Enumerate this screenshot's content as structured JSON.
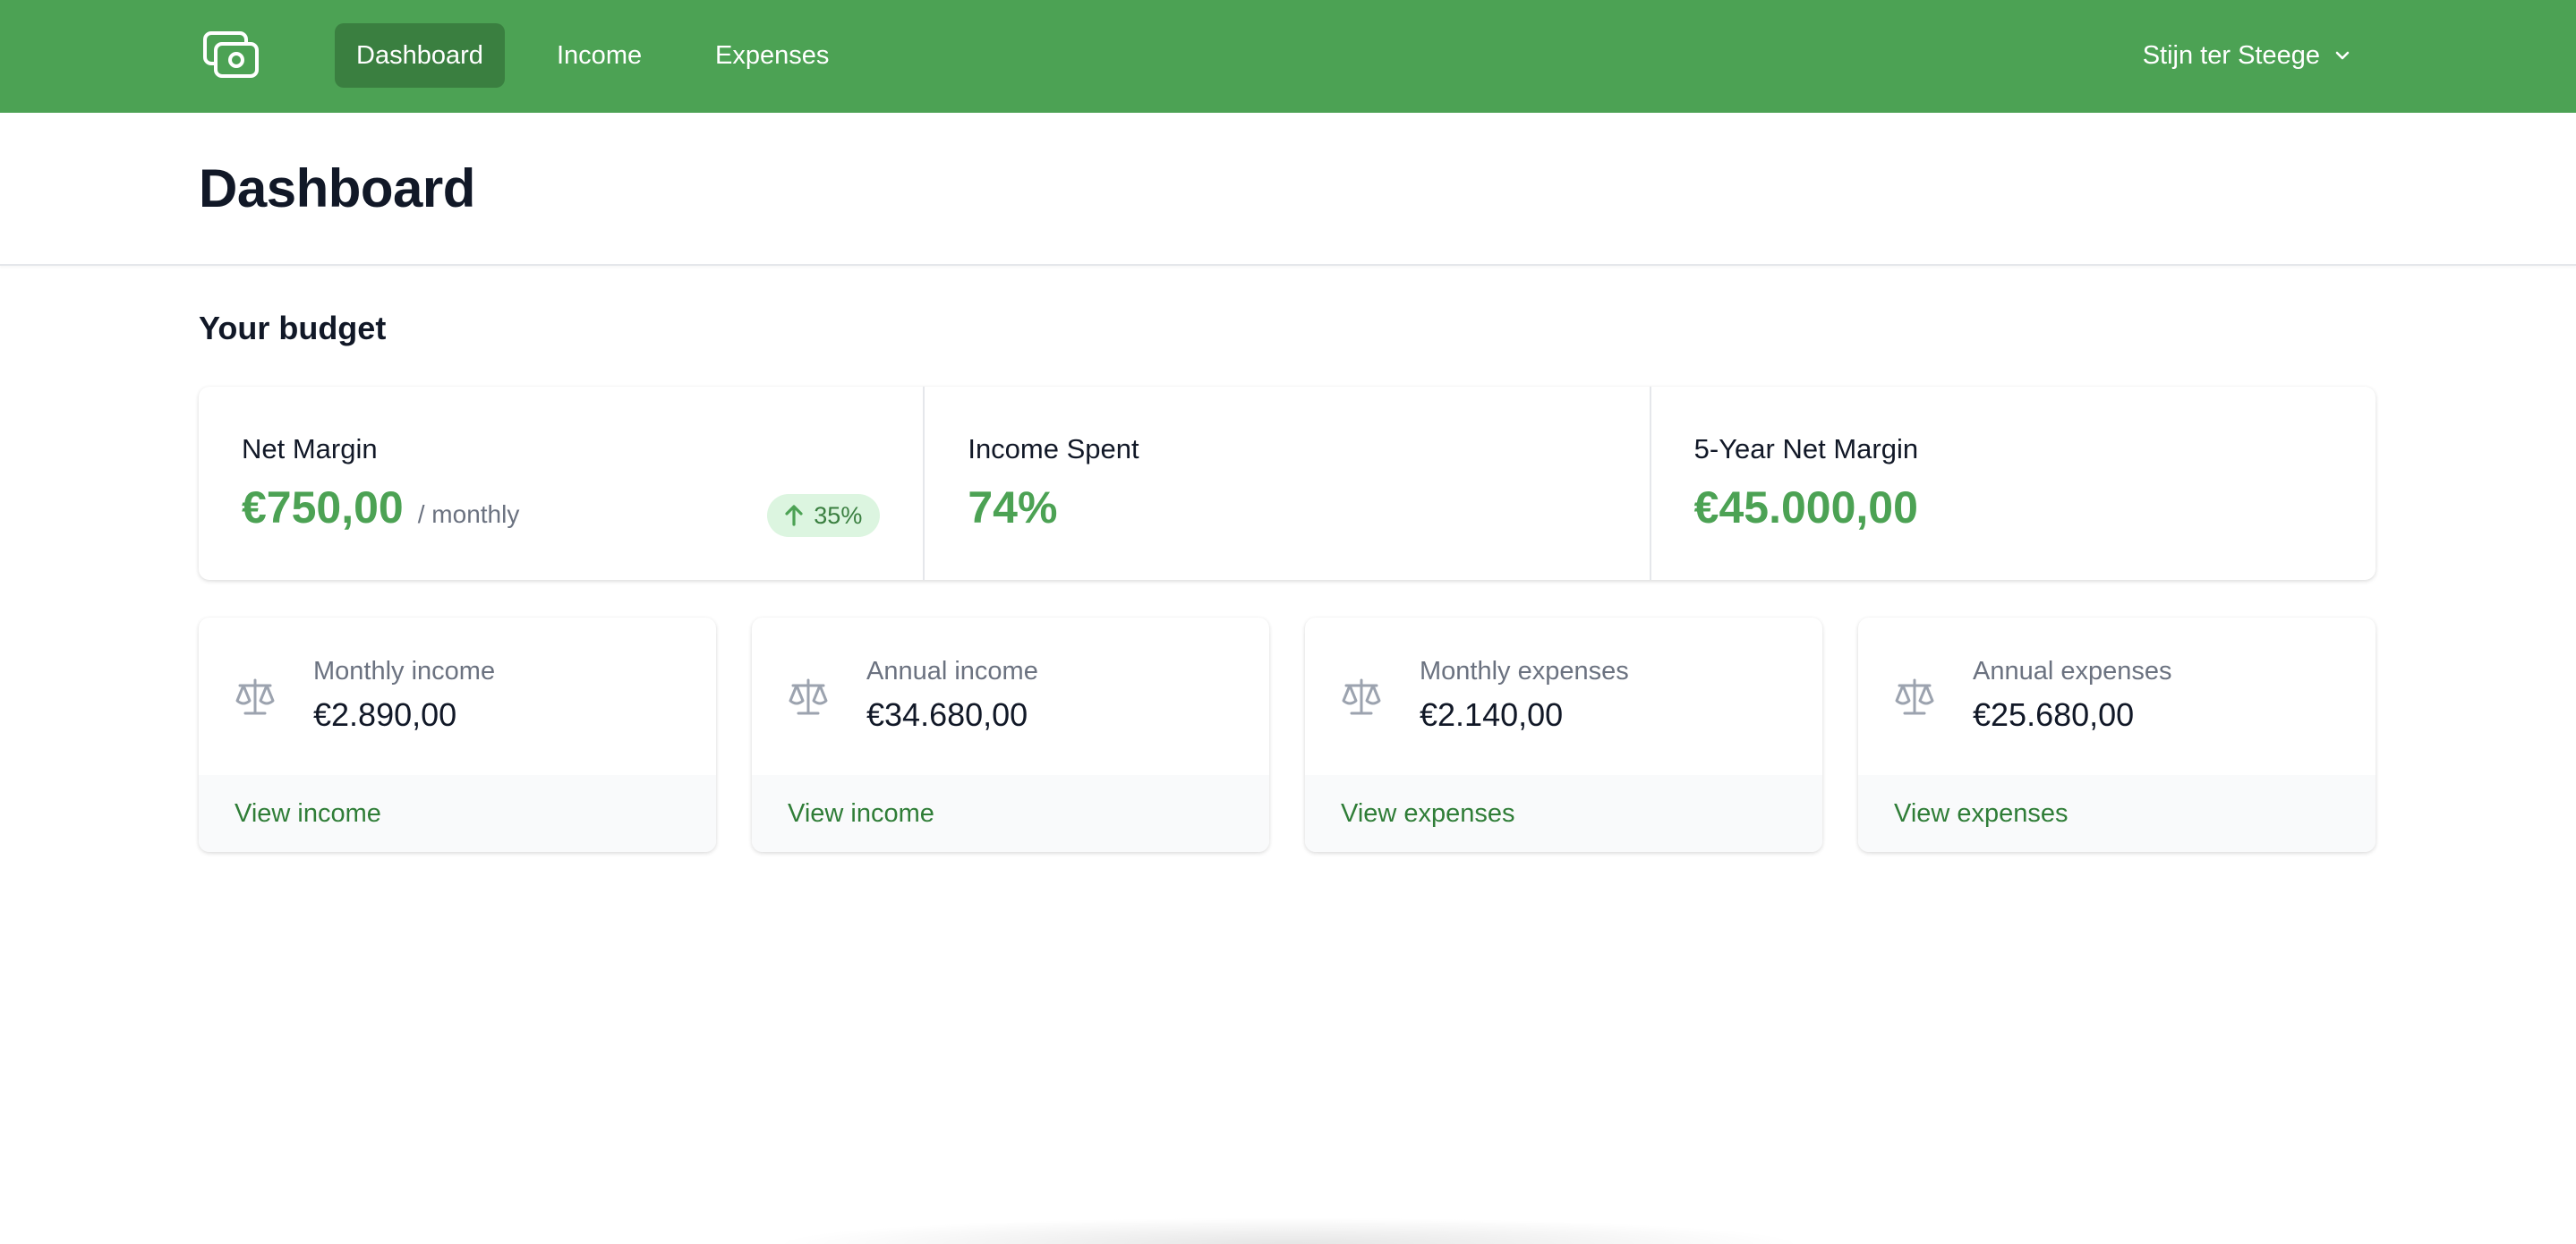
{
  "nav": {
    "logo_icon": "cash-icon",
    "items": [
      {
        "label": "Dashboard",
        "active": true
      },
      {
        "label": "Income",
        "active": false
      },
      {
        "label": "Expenses",
        "active": false
      }
    ],
    "user_name": "Stijn ter Steege",
    "user_menu_icon": "chevron-down-icon"
  },
  "header": {
    "title": "Dashboard"
  },
  "budget": {
    "section_title": "Your budget",
    "stats": [
      {
        "label": "Net Margin",
        "value": "€750,00",
        "sub": "/ monthly",
        "badge": "35%",
        "badge_icon": "arrow-up-icon"
      },
      {
        "label": "Income Spent",
        "value": "74%"
      },
      {
        "label": "5-Year Net Margin",
        "value": "€45.000,00"
      }
    ]
  },
  "cards": [
    {
      "icon": "scale-icon",
      "label": "Monthly income",
      "value": "€2.890,00",
      "link": "View income"
    },
    {
      "icon": "scale-icon",
      "label": "Annual income",
      "value": "€34.680,00",
      "link": "View income"
    },
    {
      "icon": "scale-icon",
      "label": "Monthly expenses",
      "value": "€2.140,00",
      "link": "View expenses"
    },
    {
      "icon": "scale-icon",
      "label": "Annual expenses",
      "value": "€25.680,00",
      "link": "View expenses"
    }
  ],
  "colors": {
    "brand": "#4ca254",
    "brand_dark": "#3a7f40",
    "link": "#2f7d37",
    "badge_bg": "#dcf5e0"
  }
}
